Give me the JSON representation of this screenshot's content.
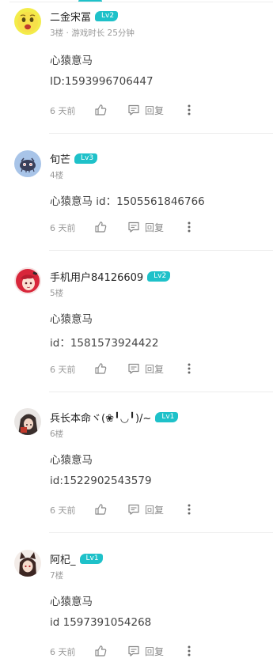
{
  "theme": {
    "accent": "#1ec1c9",
    "text_muted": "#999999"
  },
  "comments": [
    {
      "username": "二金宋冨",
      "level": "Lv2",
      "meta": "3楼 · 游戏时长 25分钟",
      "lines": [
        "心猿意马",
        "ID:1593996706447"
      ],
      "time": "6 天前",
      "reply_label": "回复",
      "avatar": "emoji-face-avatar"
    },
    {
      "username": "旬芒",
      "level": "Lv3",
      "meta": "4楼",
      "lines": [
        "心猿意马 id：1505561846766"
      ],
      "time": "6 天前",
      "reply_label": "回复",
      "avatar": "creature-avatar"
    },
    {
      "username": "手机用户84126609",
      "level": "Lv2",
      "meta": "5楼",
      "lines": [
        "心猿意马",
        " id：1581573924422"
      ],
      "time": "6 天前",
      "reply_label": "回复",
      "avatar": "red-hair-anime-avatar"
    },
    {
      "username": "兵长本命ヾ(❀╹◡╹)/~",
      "level": "Lv1",
      "meta": "6楼",
      "lines": [
        "心猿意马",
        "id:1522902543579"
      ],
      "time": "6 天前",
      "reply_label": "回复",
      "avatar": "hooded-figure-avatar"
    },
    {
      "username": "阿杞_",
      "level": "Lv1",
      "meta": "7楼",
      "lines": [
        "心猿意马",
        "id 1597391054268"
      ],
      "time": "6 天前",
      "reply_label": "回复",
      "avatar": "fox-girl-avatar"
    }
  ]
}
